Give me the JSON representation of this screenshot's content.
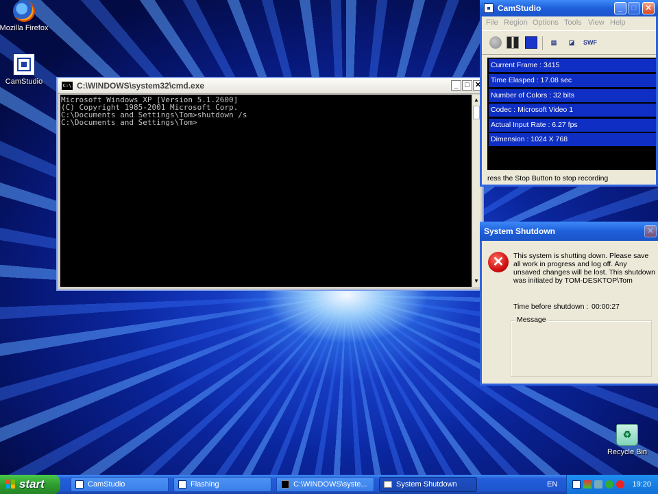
{
  "desktop": {
    "icons": [
      {
        "label": "Mozilla Firefox"
      },
      {
        "label": "CamStudio"
      },
      {
        "label": "Recycle Bin"
      }
    ]
  },
  "cmd": {
    "title": "C:\\WINDOWS\\system32\\cmd.exe",
    "icon_text": "C:\\",
    "lines": [
      "Microsoft Windows XP [Version 5.1.2600]",
      "(C) Copyright 1985-2001 Microsoft Corp.",
      "",
      "C:\\Documents and Settings\\Tom>shutdown /s",
      "",
      "C:\\Documents and Settings\\Tom>"
    ]
  },
  "camstudio": {
    "title": "CamStudio",
    "menu": [
      "File",
      "Region",
      "Options",
      "Tools",
      "View",
      "Help"
    ],
    "stats": [
      "Current Frame : 3415",
      "Time Elasped : 17.08 sec",
      "Number of Colors : 32 bits",
      "Codec : Microsoft Video 1",
      "Actual Input Rate : 6.27 fps",
      "Dimension : 1024 X 768"
    ],
    "status": "ress the Stop Button to stop recording",
    "toolbar_swf": "SWF"
  },
  "shutdown": {
    "title": "System Shutdown",
    "message": "This system is shutting down. Please save all work in progress and log off. Any unsaved changes will be lost. This shutdown was initiated by TOM-DESKTOP\\Tom",
    "time_label": "Time before shutdown :",
    "time_value": "00:00:27",
    "group_label": "Message"
  },
  "taskbar": {
    "start_label": "start",
    "tasks": [
      {
        "label": "CamStudio"
      },
      {
        "label": "Flashing"
      },
      {
        "label": "C:\\WINDOWS\\syste..."
      },
      {
        "label": "System Shutdown"
      }
    ],
    "language": "EN",
    "clock": "19:20"
  },
  "colors": {
    "xp_title_blue": "#1e5fdb",
    "stat_blue": "#0f2fc4",
    "start_green": "#2f9e2f",
    "error_red": "#d01010"
  }
}
